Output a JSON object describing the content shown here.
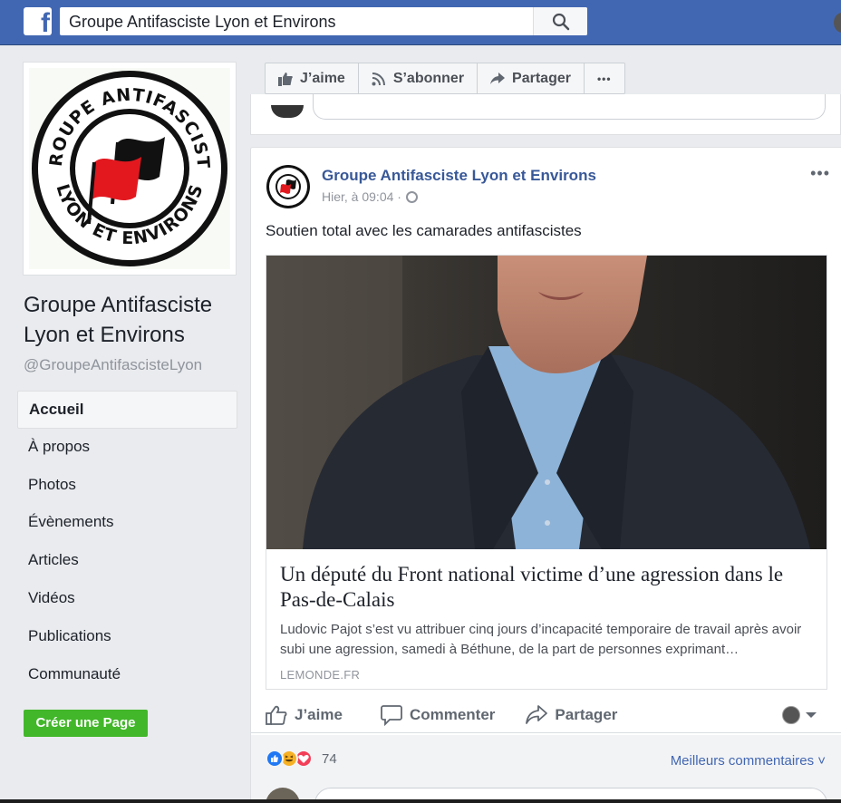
{
  "topbar": {
    "logo_letter": "f",
    "search_value": "Groupe Antifasciste Lyon et Environs"
  },
  "page": {
    "logo_text_top": "GROUPE ANTIFASCISTE",
    "logo_text_bottom": "LYON ET ENVIRONS",
    "name": "Groupe Antifasciste Lyon et Environs",
    "handle": "@GroupeAntifascisteLyon"
  },
  "nav": {
    "items": [
      {
        "label": "Accueil"
      },
      {
        "label": "À propos"
      },
      {
        "label": "Photos"
      },
      {
        "label": "Évènements"
      },
      {
        "label": "Articles"
      },
      {
        "label": "Vidéos"
      },
      {
        "label": "Publications"
      },
      {
        "label": "Communauté"
      }
    ],
    "create_page": "Créer une Page"
  },
  "actions": {
    "like": "J’aime",
    "subscribe": "S’abonner",
    "share": "Partager",
    "more": "•••"
  },
  "post": {
    "author": "Groupe Antifasciste Lyon et Environs",
    "time": "Hier, à 09:04 ·",
    "more": "•••",
    "text": "Soutien total avec les camarades antifascistes",
    "link": {
      "title": "Un député du Front national victime d’une agression dans le Pas-de-Calais",
      "description": "Ludovic Pajot s’est vu attribuer cinq jours d’incapacité temporaire de travail après avoir subi une agression, samedi à Béthune, de la part de personnes exprimant…",
      "domain": "LEMONDE.FR"
    },
    "buttons": {
      "like": "J’aime",
      "comment": "Commenter",
      "share": "Partager"
    },
    "reaction_count": "74",
    "best_comments": "Meilleurs commentaires ˅"
  },
  "colors": {
    "brand": "#4267b2",
    "link_blue": "#385898",
    "green": "#42b72a"
  }
}
